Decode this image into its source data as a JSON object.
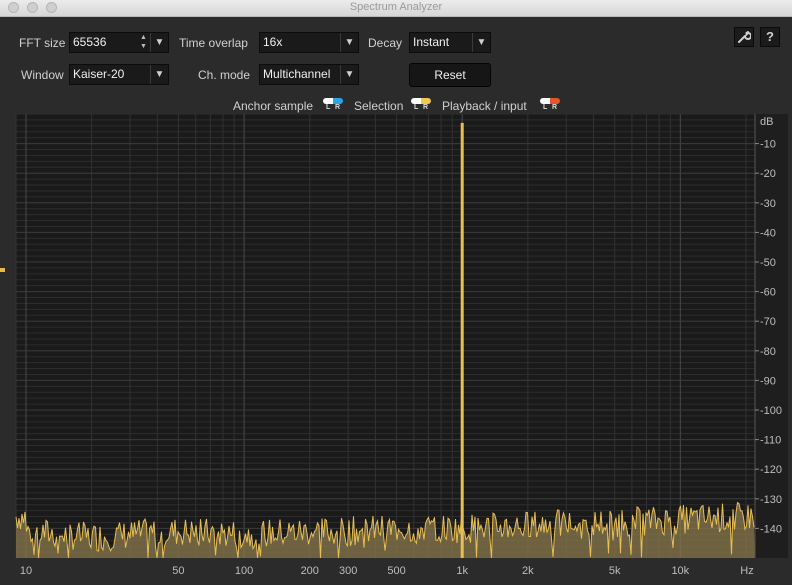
{
  "window": {
    "title": "Spectrum Analyzer"
  },
  "controls": {
    "fft_size": {
      "label": "FFT size",
      "value": "65536"
    },
    "time_overlap": {
      "label": "Time overlap",
      "value": "16x"
    },
    "decay": {
      "label": "Decay",
      "value": "Instant"
    },
    "window_fn": {
      "label": "Window",
      "value": "Kaiser-20"
    },
    "ch_mode": {
      "label": "Ch. mode",
      "value": "Multichannel"
    },
    "reset": "Reset"
  },
  "toolbar_icons": [
    "wrench-icon",
    "help-icon"
  ],
  "legend": [
    {
      "label": "Anchor sample",
      "left": "#ffffff",
      "right": "#2aa6e8"
    },
    {
      "label": "Selection",
      "left": "#ffffff",
      "right": "#f2c94c"
    },
    {
      "label": "Playback / input",
      "left": "#ffffff",
      "right": "#e2572b"
    }
  ],
  "colors": {
    "spectrum": "#e8bf55",
    "spectrum_fill": "#8a7a4e",
    "plot_bg": "#1a1a1a",
    "grid": "#3a3a3a"
  },
  "chart_data": {
    "type": "line",
    "title": "",
    "xlabel": "Hz",
    "ylabel": "dB",
    "x_scale": "log",
    "xlim": [
      9,
      22000
    ],
    "ylim": [
      -150,
      0
    ],
    "x_tick_labels": [
      "10",
      "50",
      "100",
      "200",
      "300",
      "500",
      "1k",
      "2k",
      "5k",
      "10k",
      "Hz"
    ],
    "x_tick_values": [
      10,
      50,
      100,
      200,
      300,
      500,
      1000,
      2000,
      5000,
      10000
    ],
    "y_tick_labels": [
      "dB",
      "-10",
      "-20",
      "-30",
      "-40",
      "-50",
      "-60",
      "-70",
      "-80",
      "-90",
      "-100",
      "-110",
      "-120",
      "-130",
      "-140"
    ],
    "y_tick_values": [
      -10,
      -20,
      -30,
      -40,
      -50,
      -60,
      -70,
      -80,
      -90,
      -100,
      -110,
      -120,
      -130,
      -140
    ],
    "grid": true,
    "peak": {
      "frequency": 1000,
      "level": -3
    },
    "noise_floor_level": [
      [
        10,
        -141
      ],
      [
        20,
        -143
      ],
      [
        50,
        -141
      ],
      [
        100,
        -142
      ],
      [
        200,
        -141
      ],
      [
        300,
        -141
      ],
      [
        500,
        -140
      ],
      [
        1000,
        -140
      ],
      [
        2000,
        -139
      ],
      [
        5000,
        -138
      ],
      [
        10000,
        -137
      ],
      [
        20000,
        -136
      ]
    ]
  }
}
